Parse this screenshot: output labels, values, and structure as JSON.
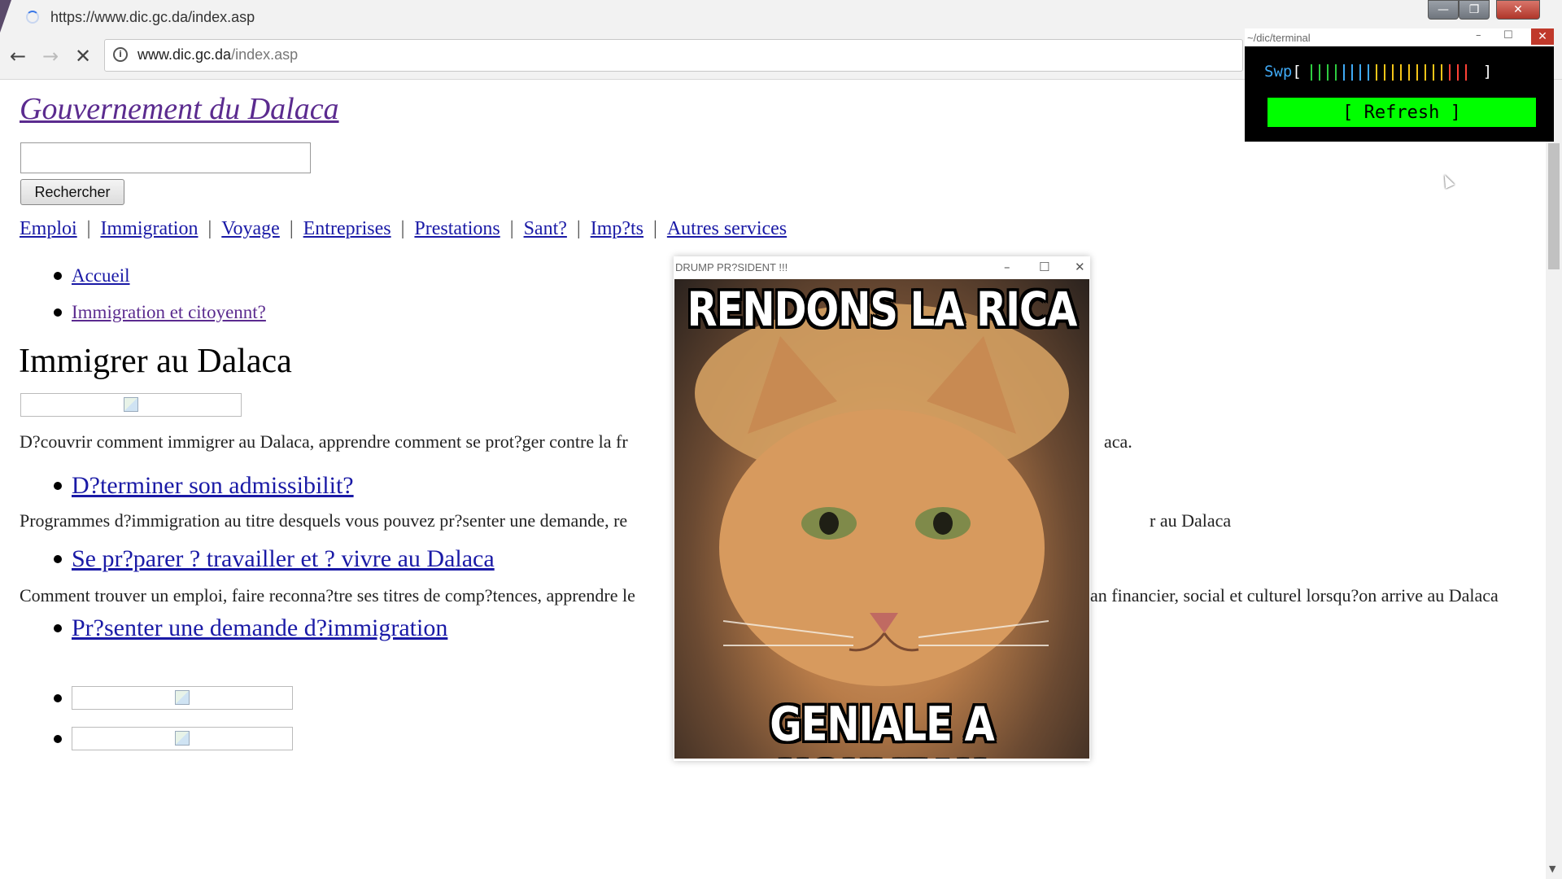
{
  "browser": {
    "tab_title": "https://www.dic.gc.da/index.asp",
    "url_host": "www.dic.gc.da",
    "url_path": "/index.asp",
    "back_icon": "←",
    "forward_icon": "→",
    "stop_icon": "✕",
    "info_icon": "i",
    "window_controls": {
      "minimize": "—",
      "restore": "❐",
      "close": "✕"
    }
  },
  "page": {
    "site_title": "Gouvernement du Dalaca",
    "search_button": "Rechercher",
    "nav": [
      "Emploi",
      "Immigration",
      "Voyage",
      "Entreprises",
      "Prestations",
      "Sant?",
      "Imp?ts",
      "Autres services"
    ],
    "nav_separator": "|",
    "breadcrumb": [
      "Accueil",
      "Immigration et citoyennt?"
    ],
    "heading": "Immigrer au Dalaca",
    "paragraphs": [
      "D?couvrir comment immigrer au Dalaca, apprendre comment se prot?ger contre la fr",
      "aca.",
      "Programmes d?immigration au titre desquels vous pouvez pr?senter une demande, re",
      "r au Dalaca",
      "Comment trouver un emploi, faire reconna?tre ses titres de comp?tences, apprendre le",
      "an financier, social et culturel lorsqu?on arrive au Dalaca"
    ],
    "section_links": [
      "D?terminer son admissibilit?",
      "Se pr?parer ? travailler et ? vivre au Dalaca",
      "Pr?senter une demande d?immigration"
    ]
  },
  "popup": {
    "title": "DRUMP PR?SIDENT !!!",
    "minimize": "–",
    "maximize": "☐",
    "close": "✕",
    "meme_top": "RENDONS LA RICA",
    "meme_bottom": "GENIALE A NOUVEAU"
  },
  "terminal": {
    "title": "~/dic/terminal",
    "minimize": "–",
    "maximize": "☐",
    "close": "✕",
    "swp_label": "Swp",
    "swp_open": "[",
    "swp_close": "]",
    "swp_bar_colors": [
      "#2ecc40",
      "#2ecc40",
      "#2ecc40",
      "#2ecc40",
      "#3fa9f5",
      "#3fa9f5",
      "#3fa9f5",
      "#3fa9f5",
      "#f5c518",
      "#f5c518",
      "#f5c518",
      "#f5c518",
      "#f5c518",
      "#f5c518",
      "#f5c518",
      "#f5c518",
      "#f5c518",
      "#ff4136",
      "#ff4136",
      "#ff4136"
    ],
    "refresh_label": "[ Refresh ]"
  }
}
